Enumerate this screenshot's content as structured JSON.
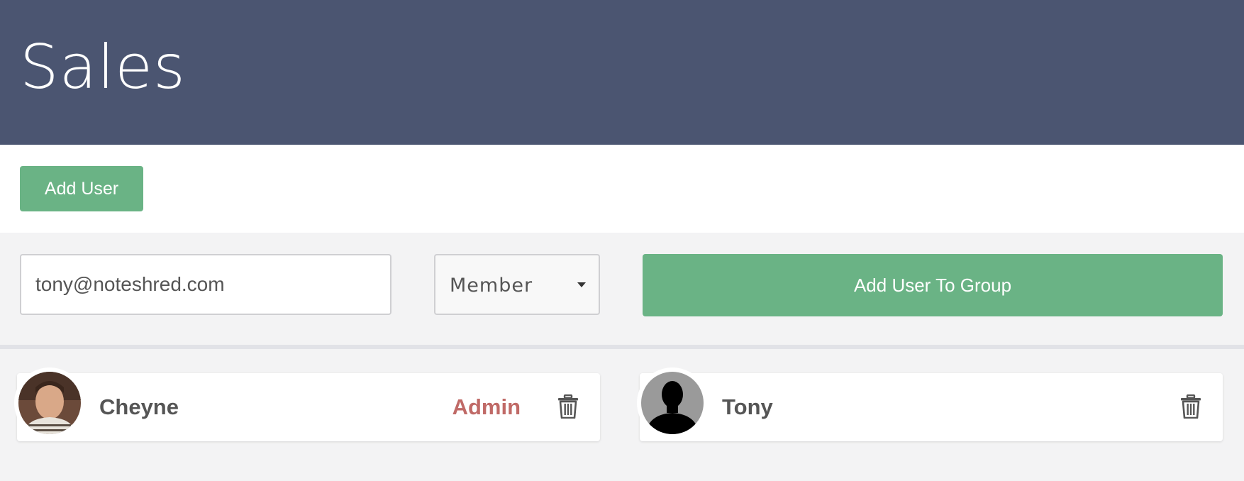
{
  "header": {
    "title": "Sales"
  },
  "toolbar": {
    "add_user_label": "Add User"
  },
  "form": {
    "email_value": "tony@noteshred.com",
    "role_selected": "Member",
    "submit_label": "Add User To Group"
  },
  "members": [
    {
      "name": "Cheyne",
      "role": "Admin",
      "avatar": "user-photo"
    },
    {
      "name": "Tony",
      "role": "",
      "avatar": "default-silhouette"
    }
  ],
  "colors": {
    "header_bg": "#4b5571",
    "accent_green": "#6ab385",
    "admin_red": "#c06a67"
  },
  "icons": [
    "trash-icon",
    "caret-down-icon",
    "avatar-photo",
    "avatar-silhouette-icon"
  ]
}
